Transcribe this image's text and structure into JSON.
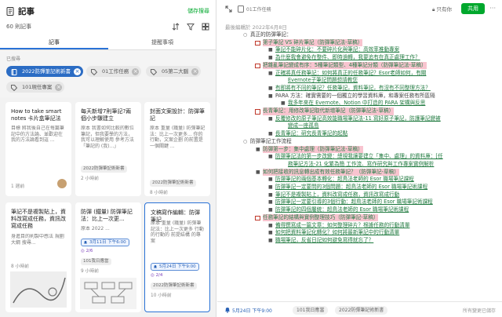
{
  "app": {
    "title": "記事",
    "save_search": "儲存搜尋",
    "note_count": "60 則記事"
  },
  "tabs": [
    "記事",
    "提醒事項"
  ],
  "filters": {
    "label": "已搜尋",
    "chips": [
      {
        "label": "2022防彈筆記術新書",
        "primary": true
      },
      {
        "label": "01工作任務"
      },
      {
        "label": "05第二大腦"
      },
      {
        "label": "101現任專案"
      }
    ]
  },
  "cards": [
    {
      "title": "How to take smart notes 卡片盒筆記法",
      "body": "目標 將我後自己在每篇筆記中的方法論、並歡迎在我的方法論看到這 ...",
      "tag": "",
      "meta": "1 週前"
    },
    {
      "title": "每天新增7則筆記?兩個小步驟建立",
      "body": "原本 我書如何比較的數位筆記，但我要學的方法，我可以理解使用 參考方法「筆記的 (我)...」",
      "tag": "2022防彈筆記術新書",
      "meta": "2 小時前"
    },
    {
      "title": "封面文案設計：防彈筆記",
      "body": "原本 重量 (鐵量) 防彈筆記法：比上一次更多... 你的行動，文案企劃 的前置是一個關鍵 ...",
      "tag": "2022防彈筆記術新書",
      "meta": "8 小時前"
    },
    {
      "title": "筆記不是複製貼上，資料改寫成任務，資訊改寫成任務",
      "body": "身進目的則製中感法 規劃大綱 搜尋...",
      "tag": "",
      "meta": "8 小時前"
    },
    {
      "title": "防彈 (鐵量) 防彈筆記法：比上一次更...",
      "body": "原本 2022 ...",
      "remind": "3月11日 下午6:00",
      "task": "2/6",
      "tag": "101我日應當",
      "meta": "9 小時前"
    },
    {
      "title": "文稿寫作編輯：防彈筆記",
      "body": "原本 重量 (鐵量) 防彈筆記法：比上一次更多 行動 的行動的 前提結構 的專案",
      "remind": "5月24日 下午9:00",
      "task": "2/4",
      "tag": "2022防彈筆記術新書",
      "meta": "10 小時前"
    }
  ],
  "note": {
    "breadcrumb": "01工作任務",
    "read_only": "只有你",
    "share": "共用",
    "updated": "最後編輯於 2022年6月8日",
    "lines": [
      {
        "indent": 0,
        "marker": "○",
        "text": "真正的防彈筆記：",
        "style": "plain"
      },
      {
        "indent": 1,
        "marker": "□",
        "text": "第子筆記 VS 碎片筆記（防彈筆記法-草稿）",
        "style": "hl"
      },
      {
        "indent": 2,
        "marker": "■",
        "text": "筆記不能碎片化：不要碎片化與筆記：高效率推動專案",
        "style": "link"
      },
      {
        "indent": 2,
        "marker": "■",
        "text": "為什麼我會避免在整件、即時過轉，我要追有在真正處理工作？",
        "style": "link"
      },
      {
        "indent": 1,
        "marker": "□",
        "text": "把雜亂筆記變成有序：5種筆記類型、4種筆記分類（防彈筆記法-草稿）",
        "style": "hl"
      },
      {
        "indent": 2,
        "marker": "■",
        "text": "正確將真任務筆記：如何將真正的任務筆記？Esor老師如何，有關",
        "style": "link"
      },
      {
        "indent": 3,
        "marker": "",
        "text": "Evernote子筆記問題想請教您",
        "style": "link"
      },
      {
        "indent": 2,
        "marker": "■",
        "text": "有即將有不同的筆記？任務筆記，資料筆記，有沒有不同整理方法？",
        "style": "link"
      },
      {
        "indent": 2,
        "marker": "■",
        "text": "PARA 方法：確實需要的一個獨立的學習資料庫，和專案任務有所區隔",
        "style": "plain"
      },
      {
        "indent": 3,
        "marker": "■",
        "text": "我多年來在 Evernote、Notion 中打造的 PARA 架構與反思",
        "style": "link"
      },
      {
        "indent": 1,
        "marker": "□",
        "text": "長青筆記：用修改筆記取代新增筆記（防彈筆記法-草稿）",
        "style": "hl"
      },
      {
        "indent": 2,
        "marker": "■",
        "text": "反覆修改的原子筆記高效能職場筆記法-11 寫好原子筆記，防護筆記變被",
        "style": "link"
      },
      {
        "indent": 3,
        "marker": "",
        "text": "變成一座孤島",
        "style": "link"
      },
      {
        "indent": 2,
        "marker": "■",
        "text": "長青筆記：研究長青筆記的起點",
        "style": "link"
      },
      {
        "indent": 0,
        "marker": "○",
        "text": "防彈筆記工作流程",
        "style": "plain"
      },
      {
        "indent": 1,
        "marker": "■",
        "text": "防彈第一步：集中處理（防彈筆記法-草稿）",
        "style": "hl"
      },
      {
        "indent": 2,
        "marker": "■",
        "text": "防彈筆記法的第一步改變：總視我讓要建立「集中、處理」的資料庫：[任",
        "style": "link"
      },
      {
        "indent": 3,
        "marker": "",
        "text": "務筆記方法-21 化繁為簡 工作流、寫作研究與工作專案實例解析",
        "style": "link"
      },
      {
        "indent": 1,
        "marker": "■",
        "text": "如何把接收的訊息轉出成有效任務筆記？（防彈筆記-草稿）",
        "style": "hl"
      },
      {
        "indent": 2,
        "marker": "■",
        "text": "防彈筆記的兩個基本轉化：超鳥法老師的 Esor 職場筆記課程",
        "style": "link"
      },
      {
        "indent": 2,
        "marker": "■",
        "text": "防彈筆記一定要問的3個問題：超鳥法老師的 Esor 職場筆記術課程",
        "style": "link"
      },
      {
        "indent": 2,
        "marker": "■",
        "text": "筆記不是複製貼上，資料改寫成任務，資訊改寫成行動",
        "style": "link"
      },
      {
        "indent": 2,
        "marker": "■",
        "text": "防彈筆記一定要引導的3個行動：超鳥法老師的 Esor 職場筆記術課程",
        "style": "link"
      },
      {
        "indent": 2,
        "marker": "■",
        "text": "防彈筆記的四個屬統：超鳥法老師的 Esor 職場筆記術課程",
        "style": "link"
      },
      {
        "indent": 1,
        "marker": "□",
        "text": "任務筆記的結構與實例整理技巧（防彈筆記-草稿）",
        "style": "hl"
      },
      {
        "indent": 2,
        "marker": "■",
        "text": "備得撰寫成一篇文章：如何整理碎片？根據任務的行動清單",
        "style": "link"
      },
      {
        "indent": 2,
        "marker": "■",
        "text": "如何把資料筆記化轉化？如何將最新筆記中的行動清單",
        "style": "link"
      },
      {
        "indent": 2,
        "marker": "■",
        "text": "職場筆記，反省日記如何避免寫得就忘了？",
        "style": "link"
      }
    ]
  },
  "bottom_bar": {
    "reminder": "5月24日 下午9:00",
    "tags": [
      "101我日應當",
      "2022防彈筆記術新書"
    ],
    "saved": "所有變更已儲存"
  },
  "colors": {
    "accent_green": "#00a82d",
    "selected_blue": "#2a72d6",
    "highlight_pink": "#f8c4cf",
    "link_green": "#1f7a3f"
  }
}
